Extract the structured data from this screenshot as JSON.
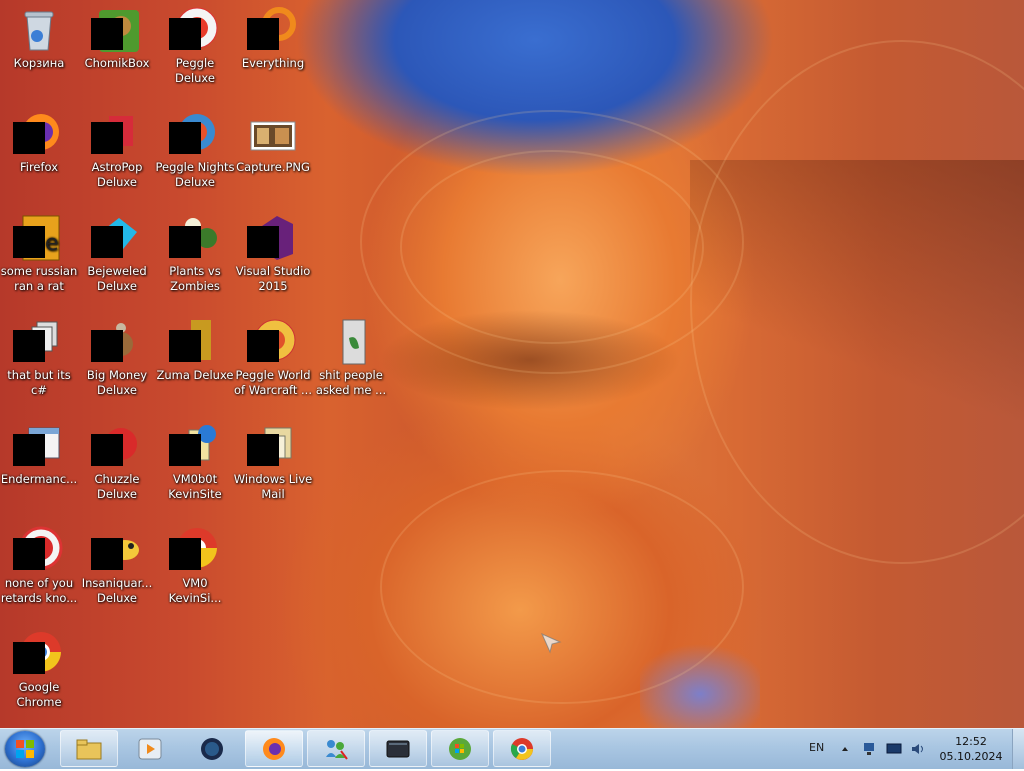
{
  "desktop": {
    "icons": [
      {
        "label": "Корзина"
      },
      {
        "label": "ChomikBox"
      },
      {
        "label": "Peggle Deluxe"
      },
      {
        "label": "Everything"
      },
      {
        "label": "Firefox"
      },
      {
        "label": "AstroPop Deluxe"
      },
      {
        "label": "Peggle Nights Deluxe"
      },
      {
        "label": "Capture.PNG"
      },
      {
        "label": "some russian ran a rat"
      },
      {
        "label": "Bejeweled Deluxe"
      },
      {
        "label": "Plants vs Zombies"
      },
      {
        "label": "Visual Studio 2015"
      },
      {
        "label": "that but its c#"
      },
      {
        "label": "Big Money Deluxe"
      },
      {
        "label": "Zuma Deluxe"
      },
      {
        "label": "Peggle World of Warcraft ..."
      },
      {
        "label": "shit people asked me ..."
      },
      {
        "label": "Endermanc..."
      },
      {
        "label": "Chuzzle Deluxe"
      },
      {
        "label": "VM0b0t KevinSite"
      },
      {
        "label": "Windows Live Mail"
      },
      {
        "label": "none of you retards kno..."
      },
      {
        "label": "Insaniquar... Deluxe"
      },
      {
        "label": "VM0 KevinSi..."
      },
      {
        "label": "Google Chrome"
      }
    ]
  },
  "taskbar": {
    "start_icon": "windows-orb",
    "pinned": [
      {
        "icon": "explorer-folder-icon"
      },
      {
        "icon": "media-player-icon"
      },
      {
        "icon": "dark-globe-icon"
      },
      {
        "icon": "firefox-icon"
      },
      {
        "icon": "people-network-icon"
      },
      {
        "icon": "window-terminal-icon"
      },
      {
        "icon": "windows-orb-icon"
      },
      {
        "icon": "chrome-icon"
      }
    ],
    "language": "EN",
    "time": "12:52",
    "date": "05.10.2024"
  }
}
